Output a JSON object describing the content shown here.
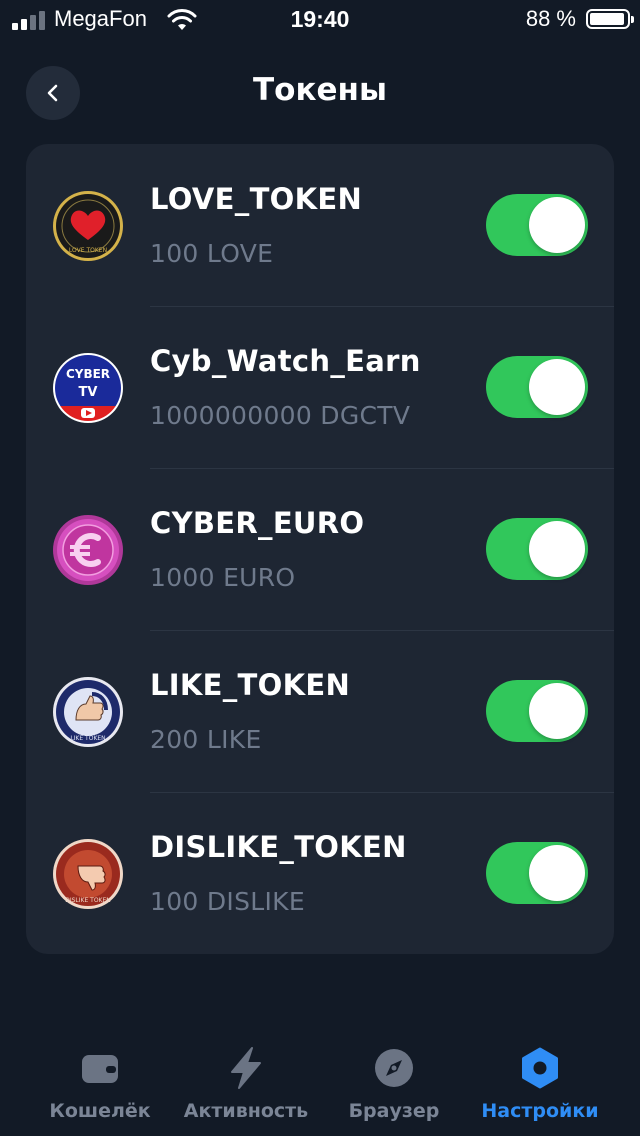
{
  "status_bar": {
    "carrier": "MegaFon",
    "time": "19:40",
    "battery": "88 %"
  },
  "header": {
    "title": "Токены"
  },
  "tokens": [
    {
      "name": "LOVE_TOKEN",
      "balance": "100 LOVE",
      "icon": "love-token-icon",
      "enabled": true
    },
    {
      "name": "Cyb_Watch_Earn",
      "balance": "1000000000 DGCTV",
      "icon": "cyber-tv-icon",
      "enabled": true
    },
    {
      "name": "CYBER_EURO",
      "balance": "1000 EURO",
      "icon": "cyber-euro-icon",
      "enabled": true
    },
    {
      "name": "LIKE_TOKEN",
      "balance": "200 LIKE",
      "icon": "like-token-icon",
      "enabled": true
    },
    {
      "name": "DISLIKE_TOKEN",
      "balance": "100 DISLIKE",
      "icon": "dislike-token-icon",
      "enabled": true
    }
  ],
  "icon_text": {
    "love": "LOVE TOKEN",
    "cyber_line1": "CYBER",
    "cyber_line2": "TV",
    "like": "LIKE TOKEN",
    "dislike": "DISLIKE TOKEN"
  },
  "tab_bar": {
    "items": [
      {
        "label": "Кошелёк",
        "icon": "wallet-icon",
        "active": false
      },
      {
        "label": "Активность",
        "icon": "lightning-icon",
        "active": false
      },
      {
        "label": "Браузер",
        "icon": "compass-icon",
        "active": false
      },
      {
        "label": "Настройки",
        "icon": "gear-hexagon-icon",
        "active": true
      }
    ]
  },
  "colors": {
    "background": "#121a26",
    "card": "#1e2633",
    "toggle_on": "#31c75b",
    "active_tab": "#2f8df5",
    "secondary_text": "#6f7a8c"
  }
}
